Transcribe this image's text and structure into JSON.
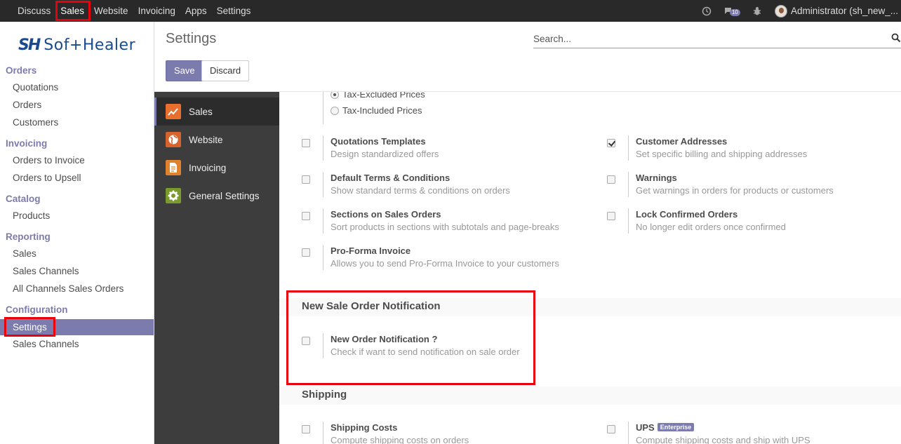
{
  "topbar": {
    "menu": [
      "Discuss",
      "Sales",
      "Website",
      "Invoicing",
      "Apps",
      "Settings"
    ],
    "active_index": 1,
    "message_count": "10",
    "user_name": "Administrator (sh_new_..."
  },
  "sidebar": {
    "logo_mark": "SH",
    "logo_text": "Sof+Healer",
    "sections": [
      {
        "title": "Orders",
        "items": [
          "Quotations",
          "Orders",
          "Customers"
        ]
      },
      {
        "title": "Invoicing",
        "items": [
          "Orders to Invoice",
          "Orders to Upsell"
        ]
      },
      {
        "title": "Catalog",
        "items": [
          "Products"
        ]
      },
      {
        "title": "Reporting",
        "items": [
          "Sales",
          "Sales Channels",
          "All Channels Sales Orders"
        ]
      },
      {
        "title": "Configuration",
        "items": [
          "Settings",
          "Sales Channels"
        ]
      }
    ]
  },
  "control_panel": {
    "title": "Settings",
    "search_placeholder": "Search...",
    "save_label": "Save",
    "discard_label": "Discard"
  },
  "apps": [
    "Sales",
    "Website",
    "Invoicing",
    "General Settings"
  ],
  "settings": {
    "radios": [
      {
        "label": "Tax-Excluded Prices",
        "checked": true
      },
      {
        "label": "Tax-Included Prices",
        "checked": false
      }
    ],
    "options_left": [
      {
        "title": "Quotations Templates",
        "desc": "Design standardized offers",
        "checked": false
      },
      {
        "title": "Default Terms & Conditions",
        "desc": "Show standard terms & conditions on orders",
        "checked": false
      },
      {
        "title": "Sections on Sales Orders",
        "desc": "Sort products in sections with subtotals and page-breaks",
        "checked": false
      },
      {
        "title": "Pro-Forma Invoice",
        "desc": "Allows you to send Pro-Forma Invoice to your customers",
        "checked": false
      }
    ],
    "options_right": [
      {
        "title": "Customer Addresses",
        "desc": "Set specific billing and shipping addresses",
        "checked": true
      },
      {
        "title": "Warnings",
        "desc": "Get warnings in orders for products or customers",
        "checked": false
      },
      {
        "title": "Lock Confirmed Orders",
        "desc": "No longer edit orders once confirmed",
        "checked": false
      }
    ],
    "notification_section": {
      "title": "New Sale Order Notification",
      "option_title": "New Order Notification ?",
      "option_desc": "Check if want to send notification on sale order"
    },
    "shipping_section": {
      "title": "Shipping",
      "left": {
        "title": "Shipping Costs",
        "desc": "Compute shipping costs on orders"
      },
      "right": {
        "title": "UPS",
        "badge": "Enterprise",
        "desc": "Compute shipping costs and ship with UPS"
      }
    }
  },
  "colors": {
    "accent": "#7c7bad",
    "highlight": "#e8000b",
    "topbar": "#292929",
    "app_list": "#3d3d3d"
  }
}
